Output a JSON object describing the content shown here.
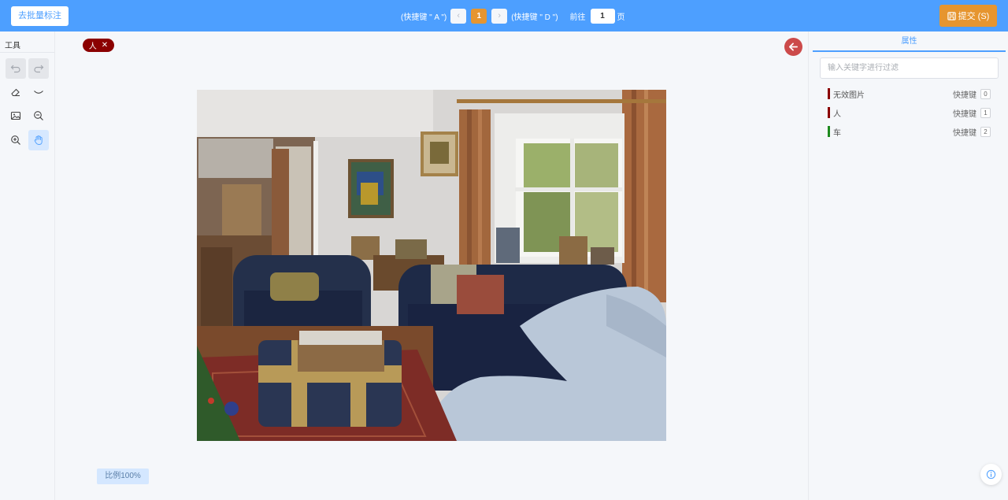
{
  "topbar": {
    "batch_label": "去批量标注",
    "prev_hint": "(快捷键 \" A \")",
    "prev_glyph": "‹",
    "current_page": "1",
    "next_glyph": "›",
    "next_hint": "(快捷键 \" D \")",
    "goto_label": "前往",
    "goto_value": "1",
    "page_unit": "页",
    "submit_label": "提交 (S)"
  },
  "tools": {
    "title": "工具",
    "items": [
      "undo-icon",
      "redo-icon",
      "eraser-icon",
      "eye-closed-icon",
      "image-icon",
      "zoom-out-icon",
      "zoom-in-icon",
      "hand-icon"
    ]
  },
  "canvas": {
    "label_chip": "人",
    "label_close": "✕",
    "scale_label": "比例100%"
  },
  "properties": {
    "tab_label": "属性",
    "filter_placeholder": "输入关键字进行过滤",
    "shortcut_label": "快捷键",
    "items": [
      {
        "name": "无效图片",
        "key": "0",
        "color": "#8b0000"
      },
      {
        "name": "人",
        "key": "1",
        "color": "#8b0000"
      },
      {
        "name": "车",
        "key": "2",
        "color": "#1e8a1e"
      }
    ]
  },
  "colors": {
    "accent": "#4d9fff",
    "submit": "#e6952f",
    "label_chip": "#8b0000",
    "back_button": "#cc4a4a"
  }
}
